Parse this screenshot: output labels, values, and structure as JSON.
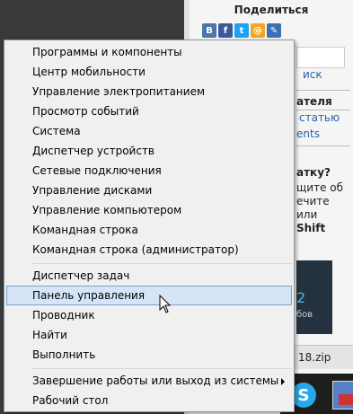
{
  "background": {
    "share_title": "Поделиться",
    "share_icons": [
      {
        "name": "vk-icon",
        "glyph": "B",
        "color": "#4a76a8"
      },
      {
        "name": "facebook-icon",
        "glyph": "f",
        "color": "#3b5998"
      },
      {
        "name": "twitter-icon",
        "glyph": "t",
        "color": "#1da1f2"
      },
      {
        "name": "mail-icon",
        "glyph": "@",
        "color": "#f5a623"
      },
      {
        "name": "blog-icon",
        "glyph": "✎",
        "color": "#3b6fb6"
      }
    ],
    "search_fragment": "иск",
    "heading_fragment": "ателя",
    "link_fragment_1": "статью",
    "link_fragment_2": "ents",
    "question_fragment": "атку?",
    "text_line_1": "щите об",
    "text_line_2": "ечите",
    "text_line_3": "или",
    "shift_text": "Shift",
    "ad_number": "2",
    "ad_sub": "бов",
    "download_file": "18.zip",
    "taskbar_skype": "S"
  },
  "menu": {
    "groups": [
      [
        {
          "label": "Программы и компоненты"
        },
        {
          "label": "Центр мобильности"
        },
        {
          "label": "Управление электропитанием"
        },
        {
          "label": "Просмотр событий"
        },
        {
          "label": "Система"
        },
        {
          "label": "Диспетчер устройств"
        },
        {
          "label": "Сетевые подключения"
        },
        {
          "label": "Управление дисками"
        },
        {
          "label": "Управление компьютером"
        },
        {
          "label": "Командная строка"
        },
        {
          "label": "Командная строка (администратор)"
        }
      ],
      [
        {
          "label": "Диспетчер задач"
        },
        {
          "label": "Панель управления",
          "highlighted": true
        },
        {
          "label": "Проводник"
        },
        {
          "label": "Найти"
        },
        {
          "label": "Выполнить"
        }
      ],
      [
        {
          "label": "Завершение работы или выход из системы",
          "submenu": true
        },
        {
          "label": "Рабочий стол"
        }
      ]
    ]
  }
}
